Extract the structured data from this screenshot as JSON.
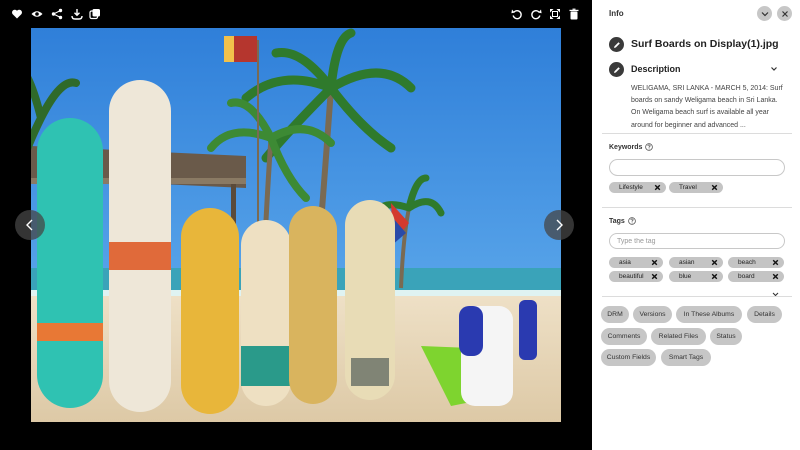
{
  "viewer": {
    "toolbar_left": [
      {
        "name": "favorite-heart-icon"
      },
      {
        "name": "view-eye-icon"
      },
      {
        "name": "share-icon"
      },
      {
        "name": "download-icon"
      },
      {
        "name": "copy-link-icon"
      }
    ],
    "toolbar_right": [
      {
        "name": "rotate-left-icon"
      },
      {
        "name": "rotate-right-icon"
      },
      {
        "name": "fit-screen-icon"
      },
      {
        "name": "delete-trash-icon"
      }
    ],
    "prev_icon": "chevron-left-icon",
    "next_icon": "chevron-right-icon"
  },
  "panel": {
    "title": "Info",
    "filename": "Surf Boards on Display(1).jpg",
    "description_label": "Description",
    "description": "WELIGAMA, SRI LANKA - MARCH 5, 2014: Surf boards on sandy Weligama beach in Sri Lanka. On Weligama beach  surf is available all year around for beginner and advanced ...",
    "keywords_label": "Keywords",
    "keywords_value": "",
    "keywords": [
      "Lifestyle",
      "Travel"
    ],
    "tags_label": "Tags",
    "tags_placeholder": "Type the tag",
    "tags": [
      "asia",
      "asian",
      "beach",
      "beautiful",
      "blue",
      "board"
    ],
    "tabs": [
      "DRM",
      "Versions",
      "In These Albums",
      "Details",
      "Comments",
      "Related Files",
      "Status",
      "Custom Fields",
      "Smart Tags"
    ]
  },
  "colors": {
    "viewer_bg": "#000000",
    "panel_bg": "#ffffff",
    "chip_bg": "#c4c4c4",
    "tab_bg": "#c6c6c6",
    "edit_button": "#3a3a3a"
  }
}
